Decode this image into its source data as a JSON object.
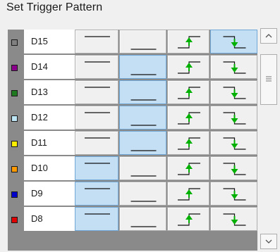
{
  "title": "Set Trigger Pattern",
  "rows": [
    {
      "label": "D15",
      "color": "#808080",
      "selected": 3
    },
    {
      "label": "D14",
      "color": "#8b008b",
      "selected": 1
    },
    {
      "label": "D13",
      "color": "#1f7a1f",
      "selected": 1
    },
    {
      "label": "D12",
      "color": "#bfe6f5",
      "selected": 1
    },
    {
      "label": "D11",
      "color": "#ffee00",
      "selected": 1
    },
    {
      "label": "D10",
      "color": "#ff9900",
      "selected": 0
    },
    {
      "label": "D9",
      "color": "#0000cc",
      "selected": 0
    },
    {
      "label": "D8",
      "color": "#e00000",
      "selected": 0
    }
  ],
  "buttons": [
    "high-level-icon",
    "low-level-icon",
    "rising-edge-icon",
    "falling-edge-icon"
  ],
  "colors": {
    "edge_arrow": "#00b000",
    "selected_fill": "#c4def3"
  },
  "scrollbar": {
    "up_icon": "chevron-up-icon",
    "down_icon": "chevron-down-icon",
    "thumb_icon": "grip-icon"
  }
}
